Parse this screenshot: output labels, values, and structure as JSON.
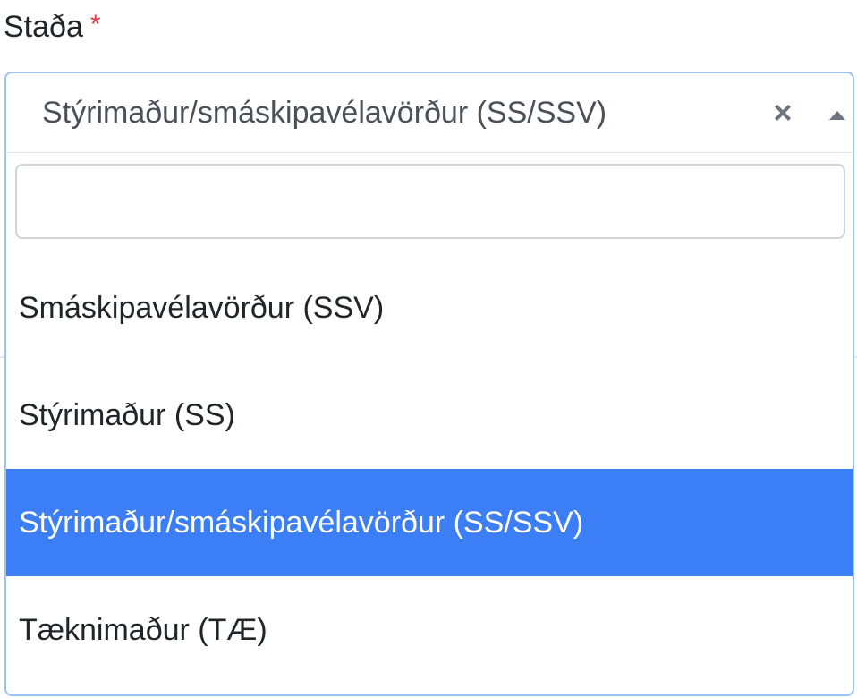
{
  "field": {
    "label": "Staða",
    "required_marker": "*"
  },
  "select": {
    "selected_value": "Stýrimaður/smáskipavélavörður (SS/SSV)",
    "clear_symbol": "×",
    "arrow_icon": "caret-up-icon",
    "state": "open"
  },
  "search": {
    "value": "",
    "placeholder": ""
  },
  "options": [
    {
      "label": "Smáskipavélavörður (SSV)",
      "highlighted": false
    },
    {
      "label": "Stýrimaður (SS)",
      "highlighted": false
    },
    {
      "label": "Stýrimaður/smáskipavélavörður (SS/SSV)",
      "highlighted": true
    },
    {
      "label": "Tæknimaður (TÆ)",
      "highlighted": false
    }
  ],
  "colors": {
    "highlight": "#3b7ef6",
    "focus_border": "#9cc2f5",
    "required": "#dc3545"
  }
}
